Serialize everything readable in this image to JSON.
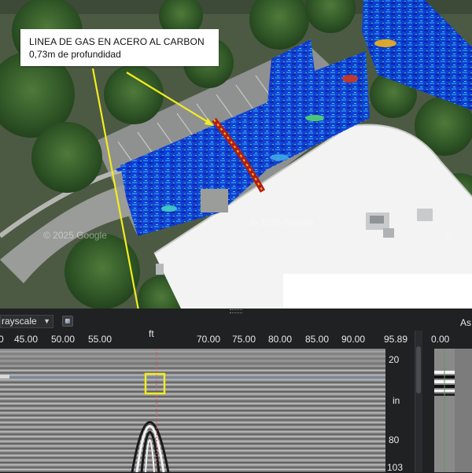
{
  "map": {
    "callout": {
      "line1": "LINEA DE GAS EN ACERO AL CARBON",
      "line2": "0,73m de profundidad"
    },
    "watermarks": [
      "© 2025 Google",
      "© 2025 Google",
      "©"
    ],
    "colors": {
      "arrow": "#f2ec1e",
      "roof": "#f2f3f2",
      "scan_low": "#0a2ad0",
      "scan_high": "#c8201a"
    }
  },
  "viewer": {
    "palette_select": {
      "value": "rayscale"
    },
    "palette_button_icon": "palette-swatch-icon",
    "right_label": "As",
    "x_unit": "ft",
    "x_ticks": [
      "45.00",
      "50.00",
      "55.00",
      "70.00",
      "75.00",
      "80.00",
      "85.00",
      "90.00",
      "95.89"
    ],
    "partial_tick": "0",
    "depth_unit": "in",
    "depth_ticks": [
      "20",
      "80",
      "103"
    ],
    "side_strip_value": "0.00",
    "colors": {
      "highlight_box": "#f2ec1e",
      "cursor_line": "#e05050",
      "horizon_line": "#7fa6d8"
    }
  }
}
